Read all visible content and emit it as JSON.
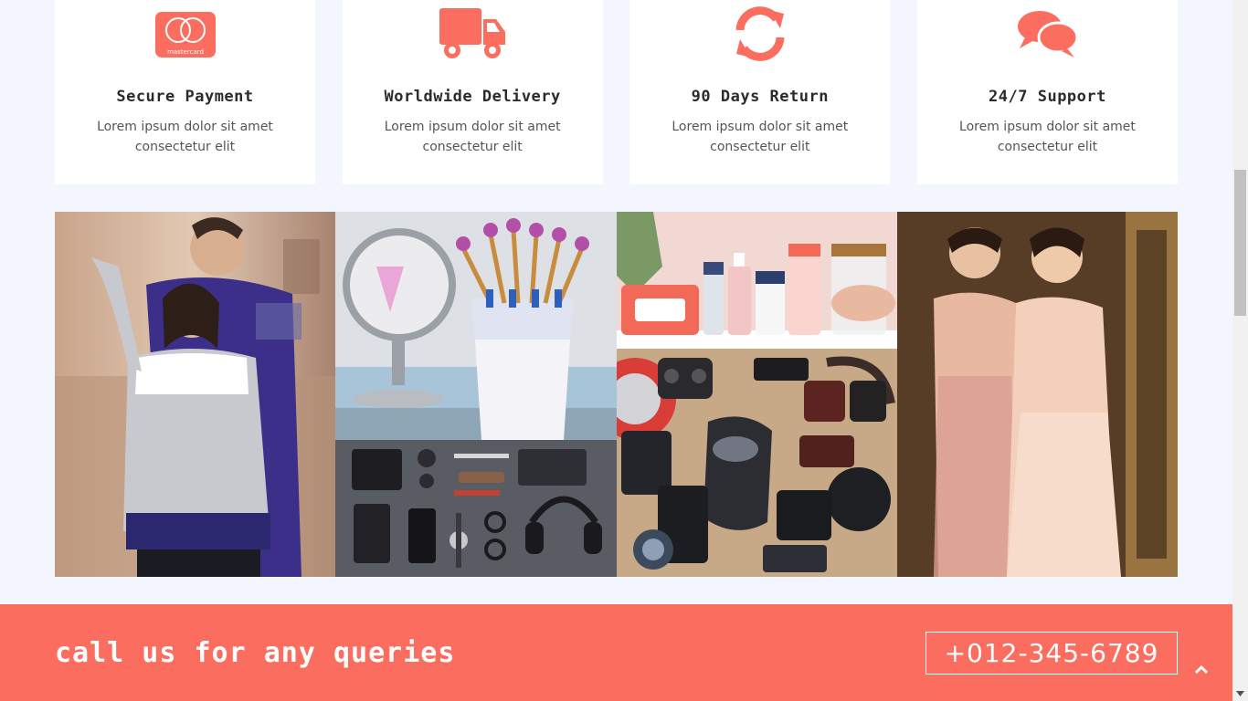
{
  "features": [
    {
      "icon": "mastercard-icon",
      "icon_text": "mastercard",
      "title": "Secure Payment",
      "desc": "Lorem ipsum dolor sit amet consectetur elit"
    },
    {
      "icon": "truck-icon",
      "title": "Worldwide Delivery",
      "desc": "Lorem ipsum dolor sit amet consectetur elit"
    },
    {
      "icon": "refresh-icon",
      "title": "90 Days Return",
      "desc": "Lorem ipsum dolor sit amet consectetur elit"
    },
    {
      "icon": "chat-bubbles-icon",
      "title": "24/7 Support",
      "desc": "Lorem ipsum dolor sit amet consectetur elit"
    }
  ],
  "mosaic": {
    "tiles": [
      "couple-sweaters",
      "makeup-brushes",
      "mens-accessories",
      "skincare-products",
      "tech-gadgets",
      "evening-dresses"
    ]
  },
  "callbar": {
    "text": "call us for any queries",
    "phone": "+012-345-6789",
    "back_to_top_icon": "chevron-up-icon"
  },
  "colors": {
    "accent": "#fa6d5f",
    "background": "#f3f6ff",
    "card": "#ffffff"
  }
}
